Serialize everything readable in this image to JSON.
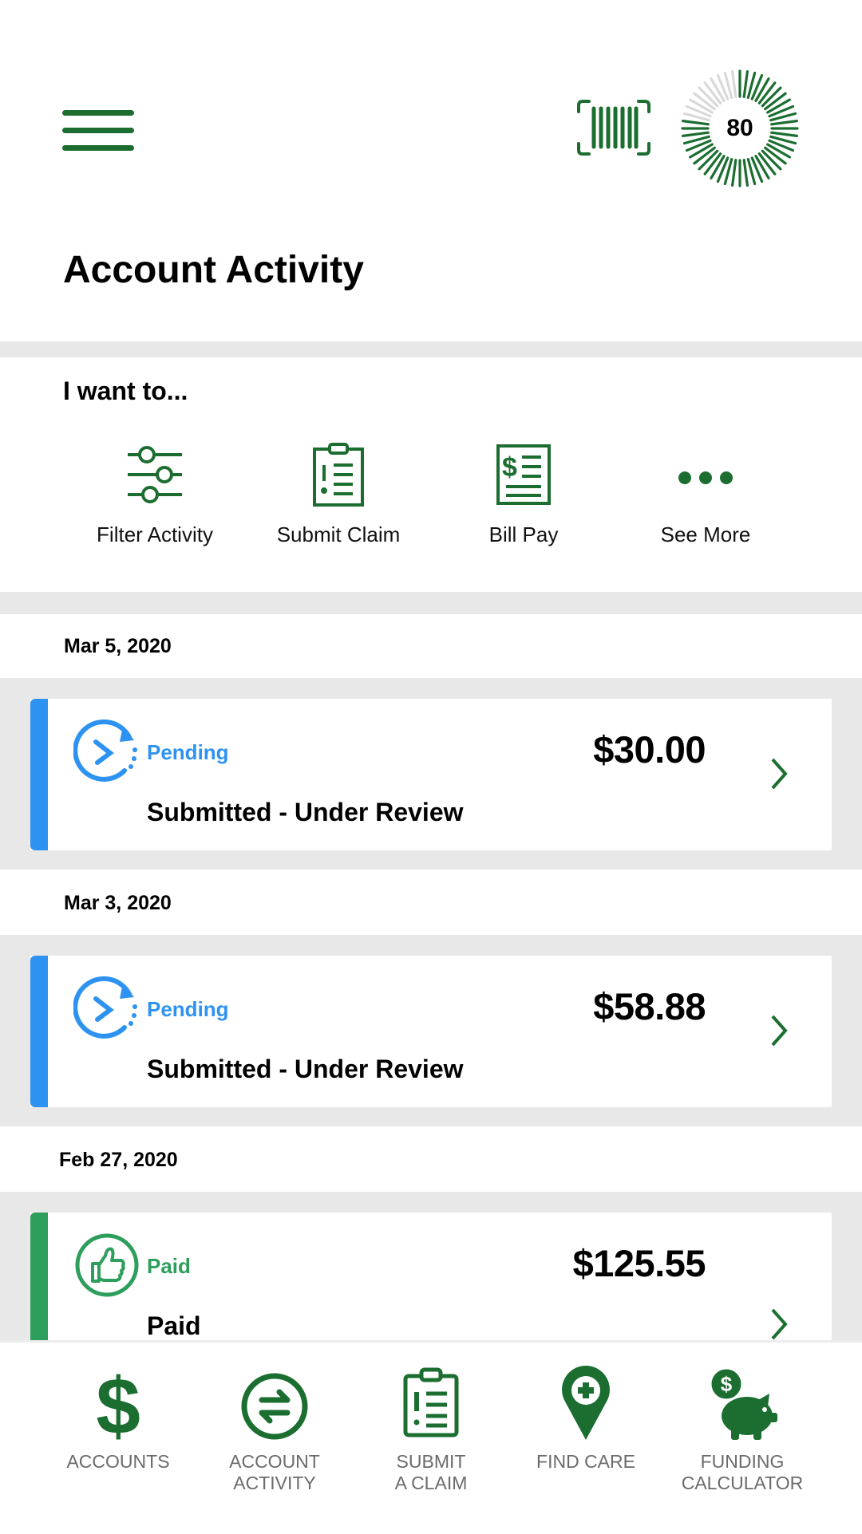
{
  "header": {
    "menu_icon": "hamburger-menu-icon",
    "barcode_icon": "barcode-scan-icon",
    "score": "80",
    "score_fraction": 0.8,
    "title": "Account Activity"
  },
  "quick_actions": {
    "heading": "I want to...",
    "items": [
      {
        "label": "Filter Activity",
        "icon": "sliders-icon"
      },
      {
        "label": "Submit Claim",
        "icon": "clipboard-icon"
      },
      {
        "label": "Bill Pay",
        "icon": "bill-icon"
      },
      {
        "label": "See More",
        "icon": "more-dots-icon"
      }
    ]
  },
  "activity": [
    {
      "date": "Mar 5, 2020",
      "status": "Pending",
      "amount": "$30.00",
      "description": "Submitted - Under Review"
    },
    {
      "date": "Mar 3, 2020",
      "status": "Pending",
      "amount": "$58.88",
      "description": "Submitted - Under Review"
    },
    {
      "date": "Feb 27, 2020",
      "status": "Paid",
      "amount": "$125.55",
      "description": "Paid"
    }
  ],
  "bottom_nav": [
    {
      "line1": "ACCOUNTS",
      "line2": "",
      "icon": "dollar-icon"
    },
    {
      "line1": "ACCOUNT",
      "line2": "ACTIVITY",
      "icon": "exchange-arrows-icon"
    },
    {
      "line1": "SUBMIT",
      "line2": "A CLAIM",
      "icon": "clipboard-icon"
    },
    {
      "line1": "FIND CARE",
      "line2": "",
      "icon": "map-pin-plus-icon"
    },
    {
      "line1": "FUNDING",
      "line2": "CALCULATOR",
      "icon": "piggy-bank-icon"
    }
  ],
  "colors": {
    "brand_green": "#1b6e30",
    "pending_blue": "#2e93f0",
    "paid_green": "#2d9e5c",
    "band_gray": "#e8e8e8",
    "nav_label_gray": "#6b6b6b"
  }
}
